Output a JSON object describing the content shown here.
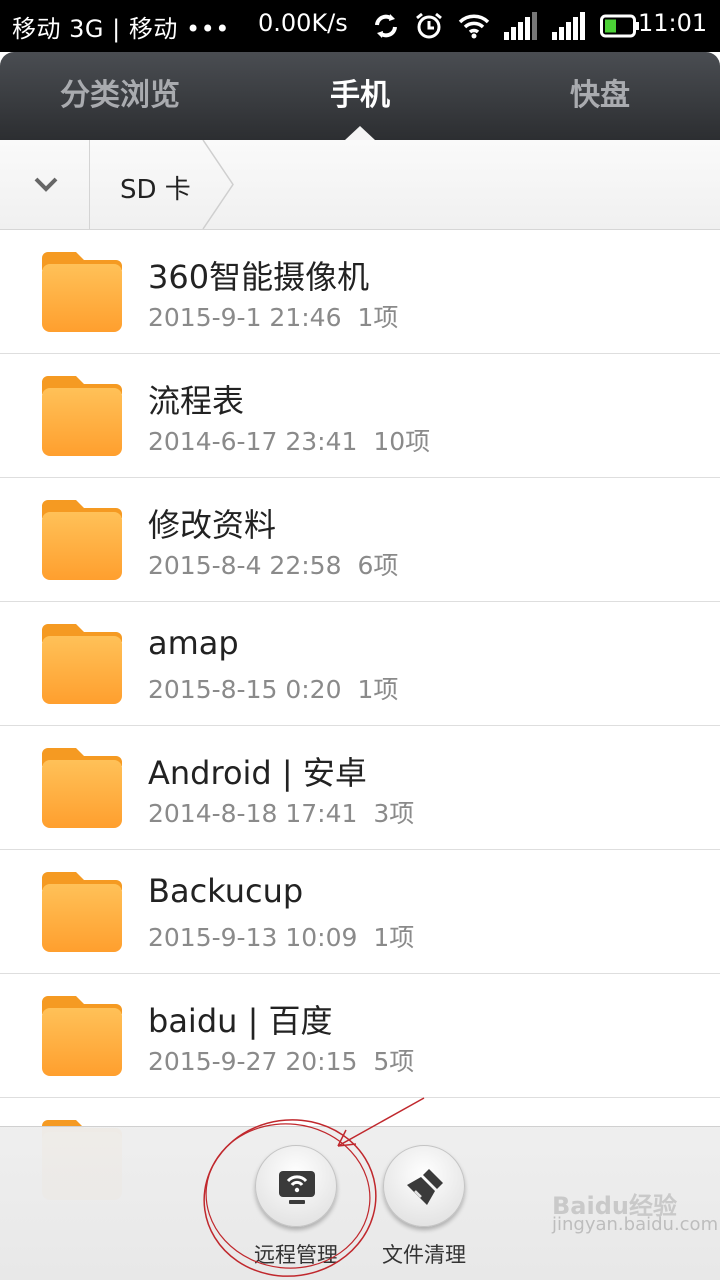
{
  "status_bar": {
    "carrier": "移动 3G | 移动 •••",
    "net_speed": "0.00K/s",
    "time": "11:01",
    "icons": [
      "sync-icon",
      "alarm-icon",
      "wifi-icon",
      "signal-icon",
      "signal-icon",
      "battery-icon"
    ]
  },
  "tabs": [
    {
      "label": "分类浏览",
      "selected": false
    },
    {
      "label": "手机",
      "selected": true
    },
    {
      "label": "快盘",
      "selected": false
    }
  ],
  "breadcrumb": {
    "items": [
      {
        "label": "SD 卡"
      }
    ]
  },
  "files": [
    {
      "name": "360智能摄像机",
      "date": "2015-9-1 21:46",
      "count": "1项"
    },
    {
      "name": "流程表",
      "date": "2014-6-17 23:41",
      "count": "10项"
    },
    {
      "name": "修改资料",
      "date": "2015-8-4 22:58",
      "count": "6项"
    },
    {
      "name": "amap",
      "date": "2015-8-15 0:20",
      "count": "1项"
    },
    {
      "name": "Android | 安卓",
      "date": "2014-8-18 17:41",
      "count": "3项"
    },
    {
      "name": "Backucup",
      "date": "2015-9-13 10:09",
      "count": "1项"
    },
    {
      "name": "baidu | 百度",
      "date": "2015-9-27 20:15",
      "count": "5项"
    }
  ],
  "actions": [
    {
      "label": "远程管理",
      "icon": "remote-manage-icon"
    },
    {
      "label": "文件清理",
      "icon": "clean-brush-icon"
    }
  ],
  "watermark": {
    "brand": "Baidu经验",
    "url": "jingyan.baidu.com"
  },
  "colors": {
    "folder": "#ffad3a",
    "annotation": "#c0282d",
    "tab_active": "#ffffff"
  }
}
